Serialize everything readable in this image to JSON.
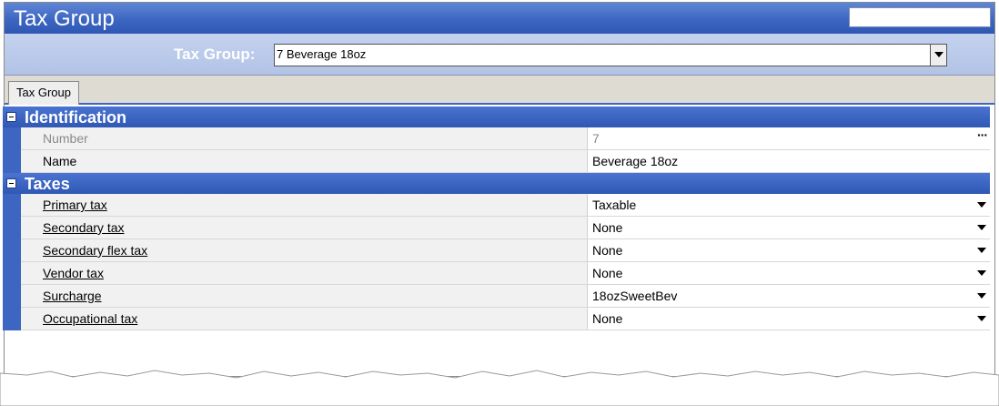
{
  "window": {
    "title": "Tax Group"
  },
  "selector": {
    "label": "Tax Group:",
    "value": "7 Beverage 18oz"
  },
  "tabs": [
    {
      "label": "Tax Group"
    }
  ],
  "categories": {
    "identification": {
      "label": "Identification",
      "rows": {
        "number": {
          "label": "Number",
          "value": "7"
        },
        "name": {
          "label": "Name",
          "value": "Beverage 18oz"
        }
      }
    },
    "taxes": {
      "label": "Taxes",
      "rows": {
        "primary_tax": {
          "label": "Primary tax",
          "value": "Taxable"
        },
        "secondary_tax": {
          "label": "Secondary tax",
          "value": "None"
        },
        "secondary_flex_tax": {
          "label": "Secondary flex tax",
          "value": "None"
        },
        "vendor_tax": {
          "label": "Vendor tax",
          "value": "None"
        },
        "surcharge": {
          "label": "Surcharge",
          "value": "18ozSweetBev"
        },
        "occupational_tax": {
          "label": "Occupational tax",
          "value": "None"
        }
      }
    }
  },
  "icons": {
    "collapse": "minus-box-icon",
    "dropdown": "chevron-down-icon",
    "ellipsis": "ellipsis-icon"
  },
  "colors": {
    "title_bar": "#3d66c2",
    "selector_bar": "#b2c3e6",
    "category_header": "#2f58b4",
    "grid_margin": "#3d66c2"
  }
}
